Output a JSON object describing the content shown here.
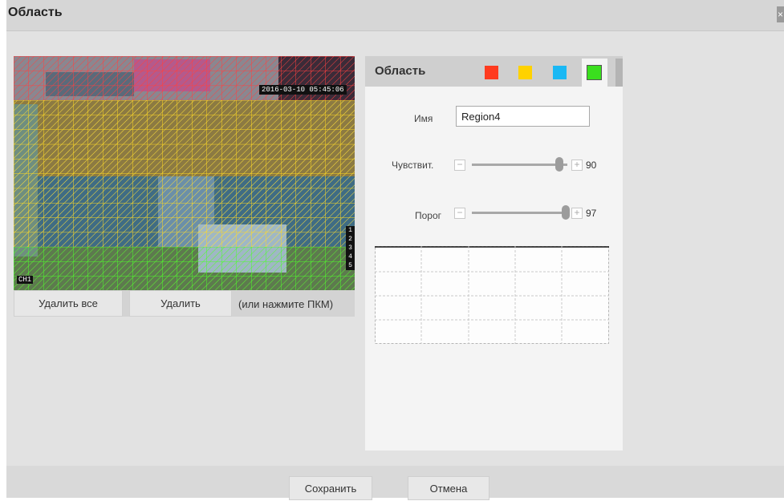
{
  "dialog": {
    "title": "Область",
    "close_glyph": "×"
  },
  "video": {
    "timestamp": "2016-03-10 05:45:06",
    "camera_label": "CH1",
    "row_numbers": [
      "1",
      "2",
      "3",
      "4",
      "5"
    ]
  },
  "video_controls": {
    "clear_all_label": "Удалить все",
    "delete_label": "Удалить",
    "hint": "(или нажмите ПКМ)"
  },
  "panel": {
    "title": "Область",
    "swatches": [
      {
        "name": "red",
        "color": "#ff3b1f"
      },
      {
        "name": "yellow",
        "color": "#ffd200"
      },
      {
        "name": "blue",
        "color": "#1ab8f4"
      },
      {
        "name": "green",
        "color": "#3adf1e",
        "selected": true
      }
    ],
    "name_label": "Имя",
    "name_value": "Region4",
    "sensitivity": {
      "label": "Чувствит.",
      "value": "90",
      "level": 0.9,
      "minus": "−",
      "plus": "+"
    },
    "threshold": {
      "label": "Порог",
      "value": "97",
      "level": 0.97,
      "minus": "−",
      "plus": "+"
    }
  },
  "footer": {
    "save_label": "Сохранить",
    "cancel_label": "Отмена"
  }
}
